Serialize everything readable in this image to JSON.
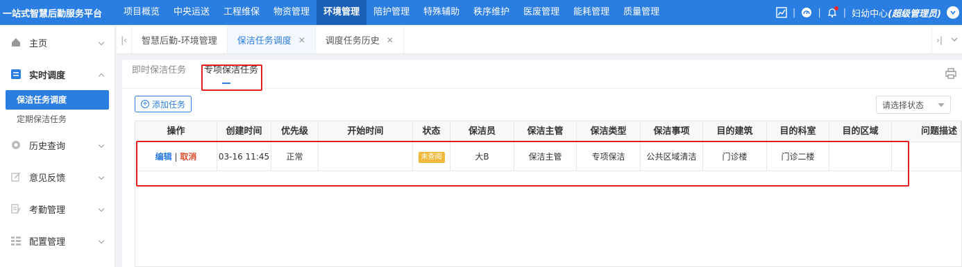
{
  "brand": "一站式智慧后勤服务平台",
  "top_nav": [
    "项目概览",
    "中央运送",
    "工程维保",
    "物资管理",
    "环境管理",
    "陪护管理",
    "特殊辅助",
    "秩序维护",
    "医废管理",
    "能耗管理",
    "质量管理"
  ],
  "top_nav_active": "环境管理",
  "user": {
    "org": "妇幼中心",
    "role": "(超级管理员)"
  },
  "sidebar": {
    "home": "主页",
    "realtime": "实时调度",
    "sub_active": "保洁任务调度",
    "sub_other": "定期保洁任务",
    "history": "历史查询",
    "feedback": "意见反馈",
    "attendance": "考勤管理",
    "config": "配置管理"
  },
  "tabs": {
    "t1": "智慧后勤-环境管理",
    "t2": "保洁任务调度",
    "t3": "调度任务历史"
  },
  "subtabs": {
    "instant": "即时保洁任务",
    "special": "专项保洁任务"
  },
  "toolbar": {
    "add_label": "添加任务",
    "status_placeholder": "请选择状态"
  },
  "table": {
    "columns": [
      "操作",
      "创建时间",
      "优先级",
      "开始时间",
      "状态",
      "保洁员",
      "保洁主管",
      "保洁类型",
      "保洁事项",
      "目的建筑",
      "目的科室",
      "目的区域",
      "问题描述"
    ],
    "row": {
      "edit": "编辑",
      "sep": "|",
      "cancel": "取消",
      "created": "03-16 11:45",
      "priority": "正常",
      "start": "",
      "status": "未查阅",
      "cleaner": "大B",
      "supervisor": "保洁主管",
      "type": "专项保洁",
      "item": "公共区域清洁",
      "building": "门诊楼",
      "dept": "门诊二楼",
      "area": "",
      "desc": ""
    }
  },
  "colors": {
    "primary": "#2a7de1",
    "active_nav": "#1a5fb8",
    "highlight": "#e02020",
    "badge": "#f0b93a"
  }
}
